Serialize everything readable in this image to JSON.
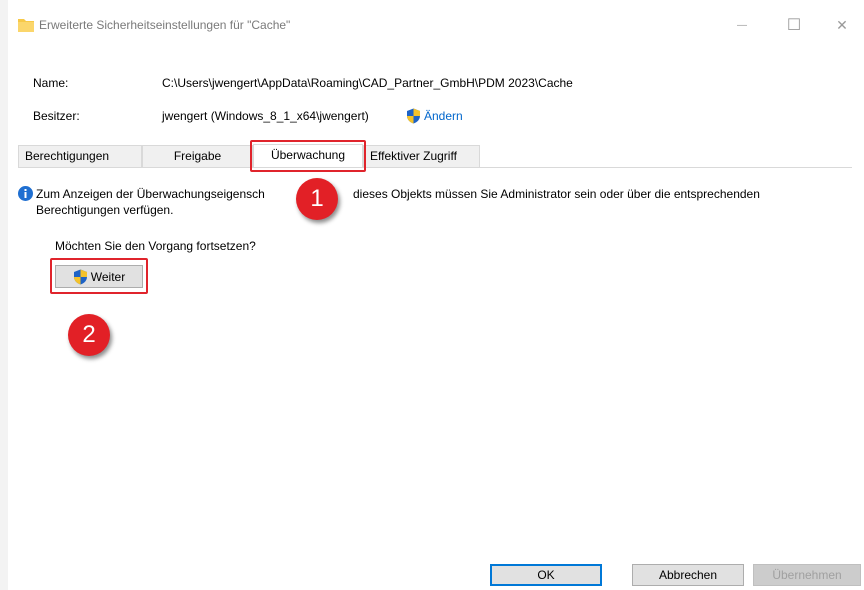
{
  "window": {
    "title": "Erweiterte Sicherheitseinstellungen für \"Cache\"",
    "controls": {
      "minimize": "—",
      "maximize": "☐",
      "close": "✕"
    }
  },
  "info": {
    "name_label": "Name:",
    "name_value": "C:\\Users\\jwengert\\AppData\\Roaming\\CAD_Partner_GmbH\\PDM 2023\\Cache",
    "owner_label": "Besitzer:",
    "owner_value": "jwengert (Windows_8_1_x64\\jwengert)",
    "change_link": "Ändern"
  },
  "tabs": [
    {
      "label": "Berechtigungen",
      "active": false
    },
    {
      "label": "Freigabe",
      "active": false
    },
    {
      "label": "Überwachung",
      "active": true
    },
    {
      "label": "Effektiver Zugriff",
      "active": false
    }
  ],
  "content": {
    "message_part1": "Zum Anzeigen der Überwachungseigensch",
    "message_part2": "dieses Objekts müssen Sie Administrator sein oder über die entsprechenden",
    "message_line2": "Berechtigungen verfügen.",
    "question": "Möchten Sie den Vorgang fortsetzen?",
    "continue_button": "Weiter"
  },
  "annotations": {
    "badge1": "1",
    "badge2": "2",
    "highlight_color": "#e0242c"
  },
  "buttons": {
    "ok": "OK",
    "cancel": "Abbrechen",
    "apply": "Übernehmen"
  },
  "icons": {
    "title": "folder-icon",
    "change": "uac-shield-icon",
    "message": "info-icon",
    "continue": "uac-shield-icon"
  }
}
